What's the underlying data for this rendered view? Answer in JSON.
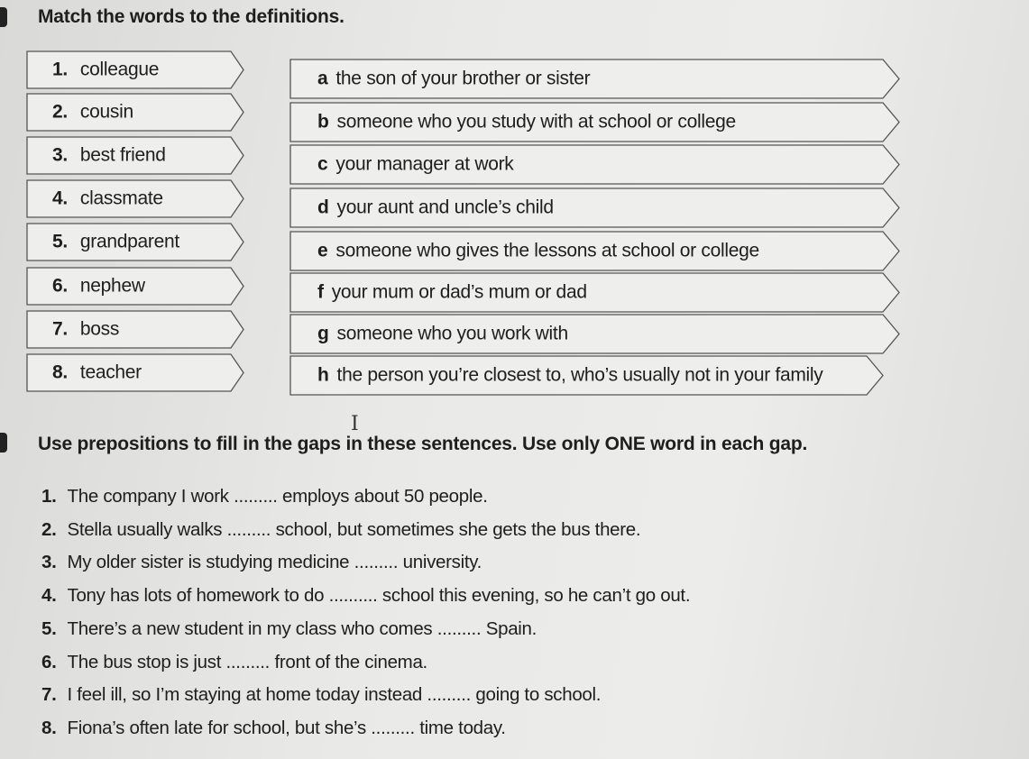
{
  "section1": {
    "title": "Match the words to the deﬁnitions.",
    "words": [
      {
        "num": "1.",
        "text": "colleague"
      },
      {
        "num": "2.",
        "text": "cousin"
      },
      {
        "num": "3.",
        "text": "best friend"
      },
      {
        "num": "4.",
        "text": "classmate"
      },
      {
        "num": "5.",
        "text": "grandparent"
      },
      {
        "num": "6.",
        "text": "nephew"
      },
      {
        "num": "7.",
        "text": "boss"
      },
      {
        "num": "8.",
        "text": "teacher"
      }
    ],
    "definitions": [
      {
        "letter": "a",
        "text": "the son of your brother or sister"
      },
      {
        "letter": "b",
        "text": "someone who you study with at school or college"
      },
      {
        "letter": "c",
        "text": "your manager at work"
      },
      {
        "letter": "d",
        "text": "your aunt and uncle’s child"
      },
      {
        "letter": "e",
        "text": "someone who gives the lessons at school or college"
      },
      {
        "letter": "f",
        "text": "your mum or dad’s mum or dad"
      },
      {
        "letter": "g",
        "text": "someone who you work with"
      },
      {
        "letter": "h",
        "text": "the person you’re closest to, who’s usually not in your family"
      }
    ]
  },
  "section2": {
    "title": "Use prepositions to fill in the gaps in these sentences. Use only ONE word in each gap.",
    "sentences": [
      {
        "num": "1.",
        "text": "The company I work ......... employs about 50 people."
      },
      {
        "num": "2.",
        "text": "Stella usually walks ......... school, but sometimes she gets the bus there."
      },
      {
        "num": "3.",
        "text": "My older sister is studying medicine ......... university."
      },
      {
        "num": "4.",
        "text": "Tony has lots of homework to do .......... school this evening, so he can’t go out."
      },
      {
        "num": "5.",
        "text": "There’s a new student in my class who comes ......... Spain."
      },
      {
        "num": "6.",
        "text": "The bus stop is just ......... front of the cinema."
      },
      {
        "num": "7.",
        "text": "I feel ill, so I’m staying at home today instead ......... going to school."
      },
      {
        "num": "8.",
        "text": "Fiona’s often late for school, but she’s ......... time today."
      }
    ]
  }
}
